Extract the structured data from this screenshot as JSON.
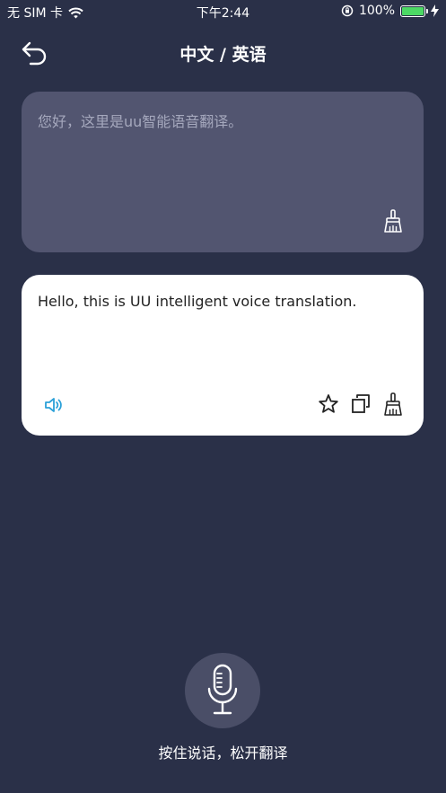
{
  "status_bar": {
    "carrier": "无 SIM 卡",
    "time": "下午2:44",
    "battery": "100%",
    "battery_level": 1.0,
    "battery_color": "#4cd964"
  },
  "nav": {
    "title": "中文 / 英语",
    "back_icon": "back-arrow-icon"
  },
  "source": {
    "text": "您好，这里是uu智能语音翻译。",
    "clear_icon": "broom-icon"
  },
  "result": {
    "text": "Hello, this is UU intelligent voice translation.",
    "speaker_icon": "speaker-icon",
    "favorite_icon": "star-icon",
    "copy_icon": "copy-icon",
    "clear_icon": "broom-icon"
  },
  "mic": {
    "icon": "microphone-icon",
    "hint": "按住说话，松开翻译"
  },
  "colors": {
    "background": "#2a3048",
    "source_card": "#525570",
    "result_card": "#ffffff",
    "accent": "#2ba0d8"
  }
}
